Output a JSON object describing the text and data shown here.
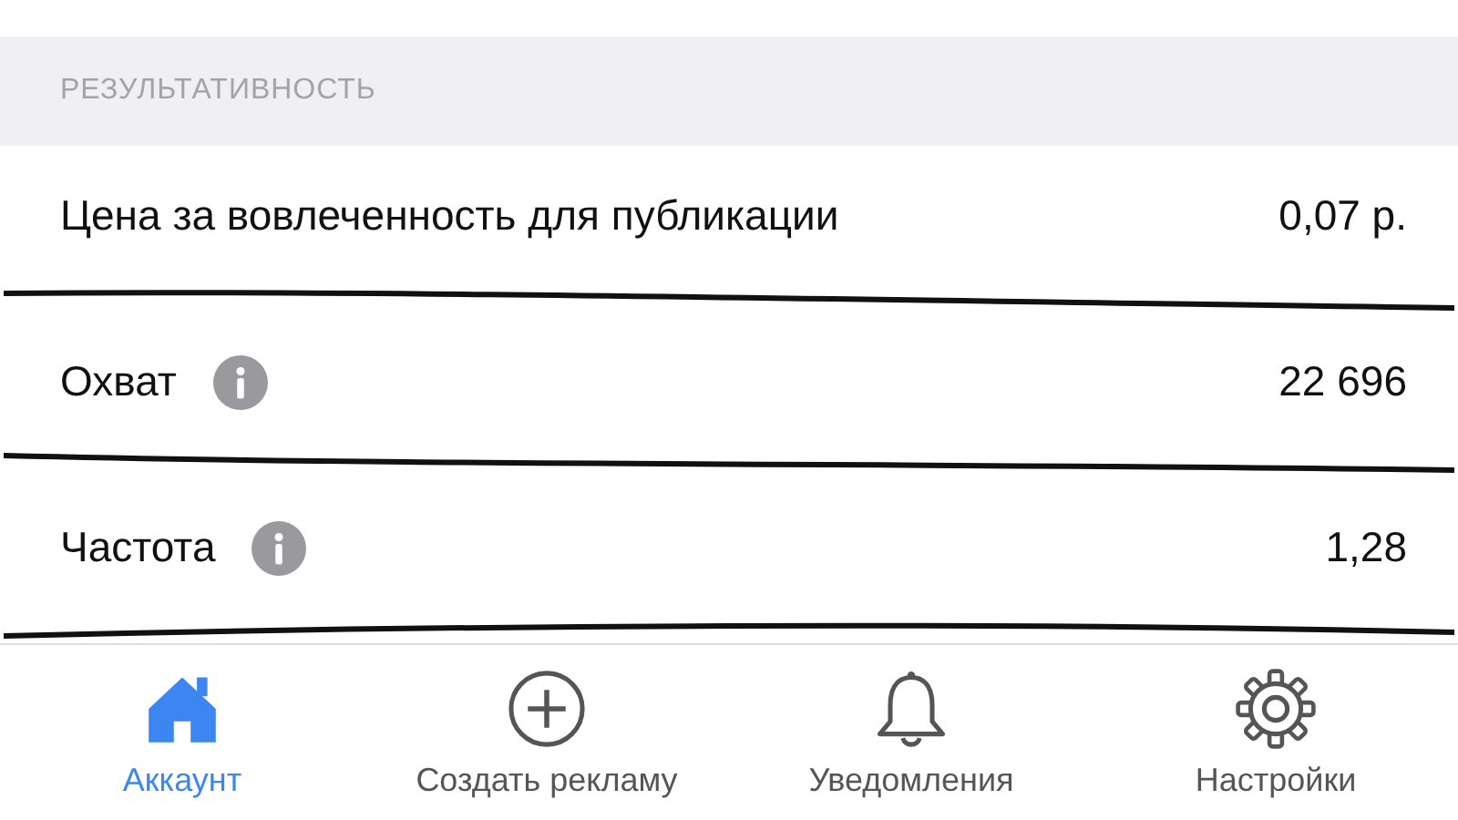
{
  "section": {
    "title": "РЕЗУЛЬТАТИВНОСТЬ"
  },
  "rows": [
    {
      "label": "Цена за вовлеченность для публикации",
      "value": "0,07 р.",
      "info": false
    },
    {
      "label": "Охват",
      "value": "22 696",
      "info": true
    },
    {
      "label": "Частота",
      "value": "1,28",
      "info": true
    }
  ],
  "tabs": [
    {
      "label": "Аккаунт",
      "kind": "home",
      "selected": true
    },
    {
      "label": "Создать рекламу",
      "kind": "plus",
      "selected": false
    },
    {
      "label": "Уведомления",
      "kind": "bell",
      "selected": false
    },
    {
      "label": "Настройки",
      "kind": "gear",
      "selected": false
    }
  ]
}
